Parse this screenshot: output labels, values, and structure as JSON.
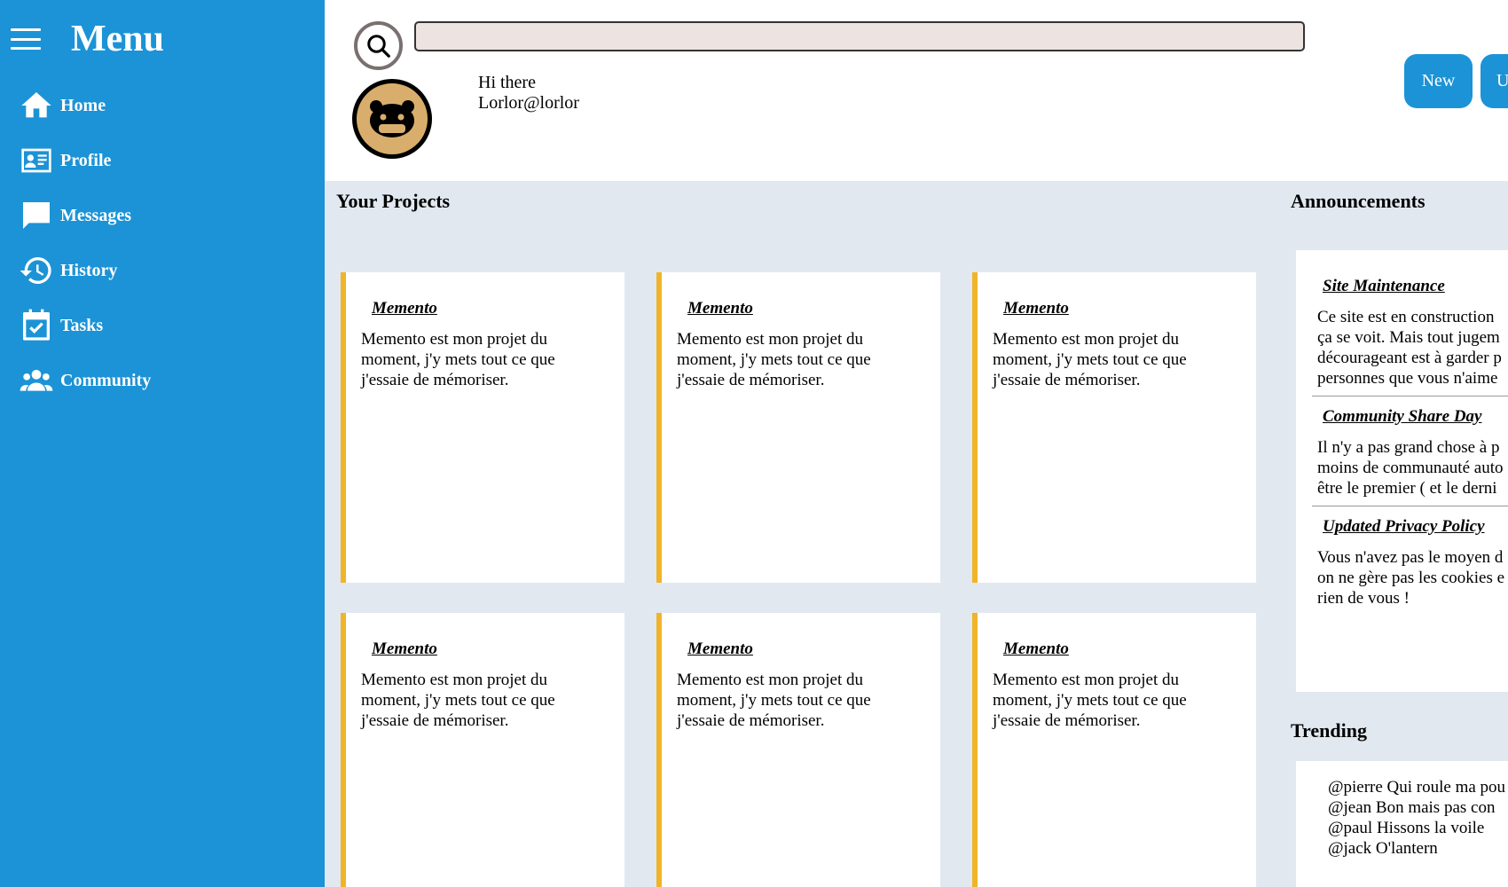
{
  "sidebar": {
    "title": "Menu",
    "items": [
      {
        "label": "Home",
        "icon": "home-icon"
      },
      {
        "label": "Profile",
        "icon": "id-card-icon"
      },
      {
        "label": "Messages",
        "icon": "chat-bubble-icon"
      },
      {
        "label": "History",
        "icon": "history-icon"
      },
      {
        "label": "Tasks",
        "icon": "calendar-check-icon"
      },
      {
        "label": "Community",
        "icon": "people-icon"
      }
    ]
  },
  "header": {
    "search": {
      "value": "",
      "placeholder": ""
    },
    "greeting_line1": "Hi there",
    "greeting_line2": "Lorlor@lorlor",
    "buttons": {
      "new_label": "New",
      "second_label": "U"
    }
  },
  "projects": {
    "title": "Your Projects",
    "cards": [
      {
        "title": "Memento",
        "text": "Memento est mon projet du moment, j'y mets tout ce que j'essaie de mémoriser."
      },
      {
        "title": "Memento",
        "text": "Memento est mon projet du moment, j'y mets tout ce que j'essaie de mémoriser."
      },
      {
        "title": "Memento",
        "text": "Memento est mon projet du moment, j'y mets tout ce que j'essaie de mémoriser."
      },
      {
        "title": "Memento",
        "text": "Memento est mon projet du moment, j'y mets tout ce que j'essaie de mémoriser."
      },
      {
        "title": "Memento",
        "text": "Memento est mon projet du moment, j'y mets tout ce que j'essaie de mémoriser."
      },
      {
        "title": "Memento",
        "text": "Memento est mon projet du moment, j'y mets tout ce que j'essaie de mémoriser."
      }
    ]
  },
  "announcements": {
    "title": "Announcements",
    "items": [
      {
        "title": "Site Maintenance",
        "lines": [
          "Ce site est en construction",
          "ça se voit. Mais tout jugem",
          "décourageant est à garder p",
          "personnes que vous n'aime"
        ]
      },
      {
        "title": "Community Share Day",
        "lines": [
          "Il n'y a pas grand chose à p",
          "moins de communauté auto",
          "être le premier ( et le derni"
        ]
      },
      {
        "title": "Updated Privacy Policy",
        "lines": [
          "Vous n'avez pas le moyen d",
          "on ne gère pas les cookies e",
          "rien de vous !"
        ]
      }
    ]
  },
  "trending": {
    "title": "Trending",
    "items": [
      "@pierre Qui roule ma pou",
      "@jean Bon mais pas con",
      "@paul Hissons la voile",
      "@jack O'lantern"
    ]
  },
  "colors": {
    "sidebar": "#1c93d6",
    "card_accent": "#f0b429",
    "main_bg": "#e2e8f0",
    "avatar_bg": "#d9ae6c"
  }
}
